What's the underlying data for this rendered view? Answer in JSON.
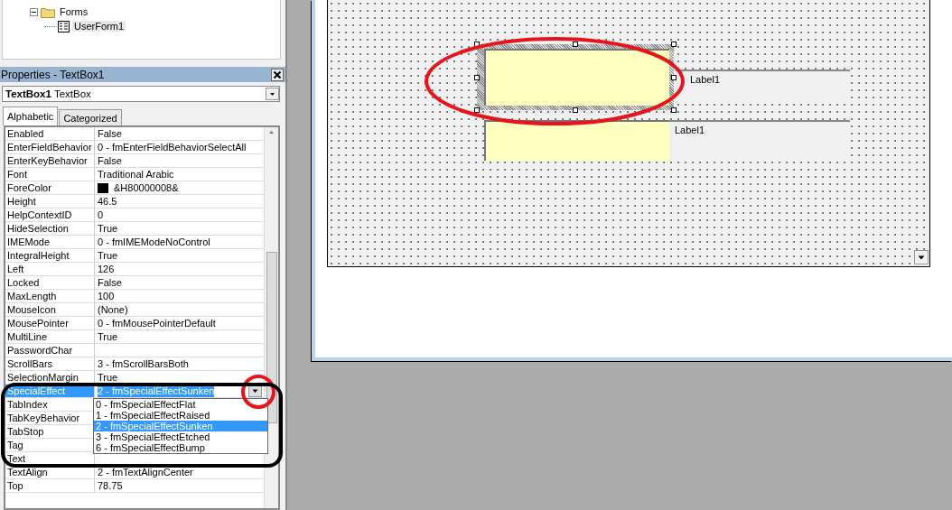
{
  "project_tree": {
    "items": [
      {
        "label": "Forms",
        "expanded": true,
        "children": [
          {
            "label": "UserForm1",
            "selected": true
          }
        ]
      }
    ]
  },
  "properties": {
    "title": "Properties - TextBox1",
    "object_selector": {
      "name": "TextBox1",
      "type": "TextBox"
    },
    "tabs": [
      {
        "label": "Alphabetic",
        "selected": true
      },
      {
        "label": "Categorized",
        "selected": false
      }
    ],
    "rows": [
      {
        "name": "Enabled",
        "value": "False",
        "selected": false
      },
      {
        "name": "EnterFieldBehavior",
        "value": "0 - fmEnterFieldBehaviorSelectAll",
        "selected": false
      },
      {
        "name": "EnterKeyBehavior",
        "value": "False",
        "selected": false
      },
      {
        "name": "Font",
        "value": "Traditional Arabic",
        "selected": false
      },
      {
        "name": "ForeColor",
        "value": "&H80000008&",
        "color": "#000000",
        "selected": false
      },
      {
        "name": "Height",
        "value": "46.5",
        "selected": false
      },
      {
        "name": "HelpContextID",
        "value": "0",
        "selected": false
      },
      {
        "name": "HideSelection",
        "value": "True",
        "selected": false
      },
      {
        "name": "IMEMode",
        "value": "0 - fmIMEModeNoControl",
        "selected": false
      },
      {
        "name": "IntegralHeight",
        "value": "True",
        "selected": false
      },
      {
        "name": "Left",
        "value": "126",
        "selected": false
      },
      {
        "name": "Locked",
        "value": "False",
        "selected": false
      },
      {
        "name": "MaxLength",
        "value": "100",
        "selected": false
      },
      {
        "name": "MouseIcon",
        "value": "(None)",
        "selected": false
      },
      {
        "name": "MousePointer",
        "value": "0 - fmMousePointerDefault",
        "selected": false
      },
      {
        "name": "MultiLine",
        "value": "True",
        "selected": false
      },
      {
        "name": "PasswordChar",
        "selected": false
      },
      {
        "name": "ScrollBars",
        "value": "3 - fmScrollBarsBoth",
        "selected": false
      },
      {
        "name": "SelectionMargin",
        "value": "True",
        "selected": false
      },
      {
        "name": "SpecialEffect",
        "value": "2 - fmSpecialEffectSunken",
        "selected": true,
        "dropdown_open": true,
        "options": [
          {
            "label": "0 - fmSpecialEffectFlat",
            "selected": false
          },
          {
            "label": "1 - fmSpecialEffectRaised",
            "selected": false
          },
          {
            "label": "2 - fmSpecialEffectSunken",
            "selected": true
          },
          {
            "label": "3 - fmSpecialEffectEtched",
            "selected": false
          },
          {
            "label": "6 - fmSpecialEffectBump",
            "selected": false
          }
        ]
      },
      {
        "name": "TabIndex",
        "selected": false
      },
      {
        "name": "TabKeyBehavior",
        "selected": false
      },
      {
        "name": "TabStop",
        "selected": false
      },
      {
        "name": "Tag",
        "selected": false
      },
      {
        "name": "Text",
        "selected": false
      },
      {
        "name": "TextAlign",
        "value": "2 - fmTextAlignCenter",
        "selected": false
      },
      {
        "name": "Top",
        "value": "78.75",
        "selected": false
      }
    ]
  },
  "designer": {
    "controls": [
      {
        "kind": "textbox",
        "selected": true
      },
      {
        "kind": "label",
        "text": "Label1",
        "selected": false
      },
      {
        "kind": "textbox",
        "selected": false
      },
      {
        "kind": "label",
        "text": "Label1",
        "selected": false
      }
    ]
  },
  "annotations": [
    {
      "kind": "ellipse",
      "color": "#e8141c"
    },
    {
      "kind": "circle",
      "color": "#e8141c"
    },
    {
      "kind": "rounded-rect",
      "color": "#000000"
    }
  ]
}
